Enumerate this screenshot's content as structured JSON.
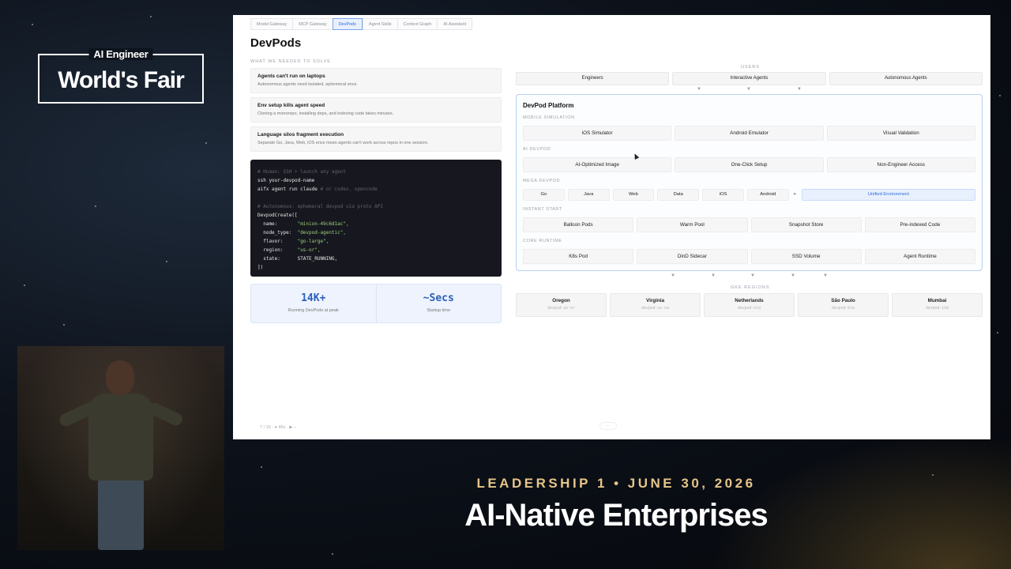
{
  "event": {
    "logo_top": "AI Engineer",
    "logo_main": "World's Fair",
    "session_label": "LEADERSHIP 1 • JUNE 30, 2026",
    "session_title": "AI-Native Enterprises"
  },
  "slide": {
    "tabs": [
      "Model Gateway",
      "MCP Gateway",
      "DevPods",
      "Agent Skills",
      "Context Graph",
      "AI Assistant"
    ],
    "active_tab": "DevPods",
    "title": "DevPods",
    "problems_caption": "WHAT WE NEEDED TO SOLVE",
    "problems": [
      {
        "title": "Agents can't run on laptops",
        "desc": "Autonomous agents need isolated, ephemeral envs."
      },
      {
        "title": "Env setup kills agent speed",
        "desc": "Cloning a monorepo, installing deps, and indexing code takes minutes."
      },
      {
        "title": "Language silos fragment execution",
        "desc": "Separate Go, Java, Web, iOS envs mean agents can't work across repos in one session."
      }
    ],
    "code": {
      "c1": "# Human: SSH + launch any agent",
      "l2": "ssh your-devpod-name",
      "l3a": "aifx agent run claude ",
      "l3b": "# or codex, opencode",
      "c5": "# Autonomous: ephemeral devpod via proto API",
      "l6": "DevpodCreate([",
      "k_name": "  name:       ",
      "v_name": "\"minion-49c6d1ac\",",
      "k_type": "  node_type:  ",
      "v_type": "\"devpod-agentic\",",
      "k_flavor": "  flavor:     ",
      "v_flavor": "\"go-large\",",
      "k_region": "  region:     ",
      "v_region": "\"us-or\",",
      "k_state": "  state:      ",
      "v_state": "STATE_RUNNING,",
      "l_end": "])"
    },
    "stats": [
      {
        "value": "14K+",
        "label": "Running DevPods at peak"
      },
      {
        "value": "~Secs",
        "label": "Startup time"
      }
    ],
    "footer_nav": "7 / 16  ·  ● 45s  ·  ▶ –",
    "footer_dot": "···",
    "users_caption": "USERS",
    "users": [
      "Engineers",
      "Interactive Agents",
      "Autonomous Agents"
    ],
    "platform": {
      "title": "DevPod Platform",
      "mobile_caption": "MOBILE SIMULATION",
      "mobile": [
        "iOS Simulator",
        "Android Emulator",
        "Visual Validation"
      ],
      "ai_caption": "AI DEVPOD",
      "ai": [
        "AI-Optimized Image",
        "One-Click Setup",
        "Non-Engineer Access"
      ],
      "mega_caption": "MEGA DEVPOD",
      "mega": [
        "Go",
        "Java",
        "Web",
        "Data",
        "iOS",
        "Android"
      ],
      "mega_arrow": "►",
      "mega_unified": "Unified Environment",
      "instant_caption": "INSTANT START",
      "instant": [
        "Balloon Pods",
        "Warm Pool",
        "Snapshot Store",
        "Pre-indexed Code"
      ],
      "core_caption": "CORE RUNTIME",
      "core": [
        "K8s Pod",
        "DinD Sidecar",
        "SSD Volume",
        "Agent Runtime"
      ]
    },
    "gke_caption": "GKE REGIONS",
    "regions": [
      {
        "name": "Oregon",
        "code": "devpod-us-or"
      },
      {
        "name": "Virginia",
        "code": "devpod-us-va"
      },
      {
        "name": "Netherlands",
        "code": "devpod-nld"
      },
      {
        "name": "São Paulo",
        "code": "devpod-bra"
      },
      {
        "name": "Mumbai",
        "code": "devpod-ind"
      }
    ]
  }
}
